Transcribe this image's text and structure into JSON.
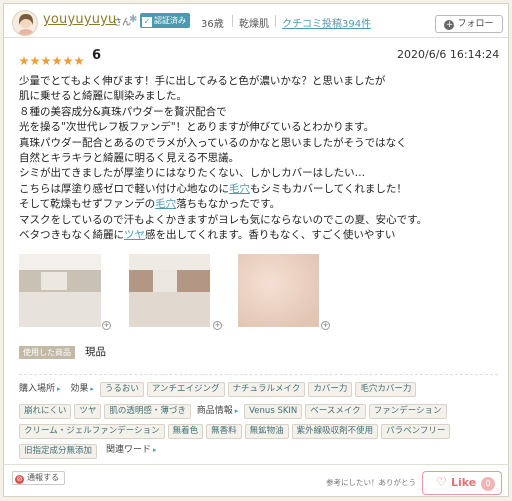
{
  "header": {
    "username": "youyuyuyu",
    "honorific": "さん",
    "verified": "認証済み",
    "age": "36歳",
    "skin_type": "乾燥肌",
    "kuchikomi_count": "クチコミ投稿394件",
    "follow_label": "フォロー"
  },
  "review": {
    "rating": 6,
    "rating_max": 7,
    "score": "6",
    "datetime": "2020/6/6 16:14:24",
    "lines": [
      "少量でとてもよく伸びます！手に出してみると色が濃いかな？と思いましたが",
      "肌に乗せると綺麗に馴染みました。",
      "８種の美容成分&真珠パウダーを贅沢配合で",
      "光を操る\"次世代レフ板ファンデ\"！とありますが伸びているとわかります。",
      "真珠パウダー配合とあるのでラメが入っているのかなと思いましたがそうではなく",
      "自然とキラキラと綺麗に明るく見える不思議。",
      "シミが出てきましたが厚塗りにはなりたくない、しかしカバーはしたい…"
    ],
    "line8_a": "こちらは厚塗り感ゼロで軽い付け心地なのに",
    "line8_link": "毛穴",
    "line8_b": "もシミもカバーしてくれました！",
    "line9_a": "そして乾燥もせずファンデの",
    "line9_link": "毛穴",
    "line9_b": "落ちもなかったです。",
    "line10": "マスクをしているので汗もよくかきますがヨレも気にならないのでこの夏、安心です。",
    "line11_a": "ベタつきもなく綺麗に",
    "line11_link": "ツヤ",
    "line11_b": "感を出してくれます。香りもなく、すごく使いやすい"
  },
  "used": {
    "label": "使用した商品",
    "value": "現品"
  },
  "tags": {
    "place_label": "購入場所",
    "effect_label": "効果",
    "effects_row1": [
      "うるおい",
      "アンチエイジング",
      "ナチュラルメイク",
      "カバー力",
      "毛穴カバー力"
    ],
    "effects_row2": [
      "崩れにくい",
      "ツヤ",
      "肌の透明感・薄づき"
    ],
    "product_label": "商品情報",
    "product_row2": [
      "Venus SKIN",
      "ベースメイク",
      "ファンデーション"
    ],
    "product_row3": [
      "クリーム・ジェルファンデーション",
      "無着色",
      "無香料",
      "無鉱物油",
      "紫外線吸収剤不使用",
      "パラベンフリー"
    ],
    "product_row4": [
      "旧指定成分無添加"
    ],
    "related_label": "関連ワード"
  },
  "footer": {
    "report": "通報する",
    "helpful": "参考にしたい！ありがとう",
    "like": "Like",
    "like_count": "0"
  },
  "colors": {
    "accent": "#4b9bb0",
    "star": "#f29b32",
    "like": "#e07575"
  }
}
